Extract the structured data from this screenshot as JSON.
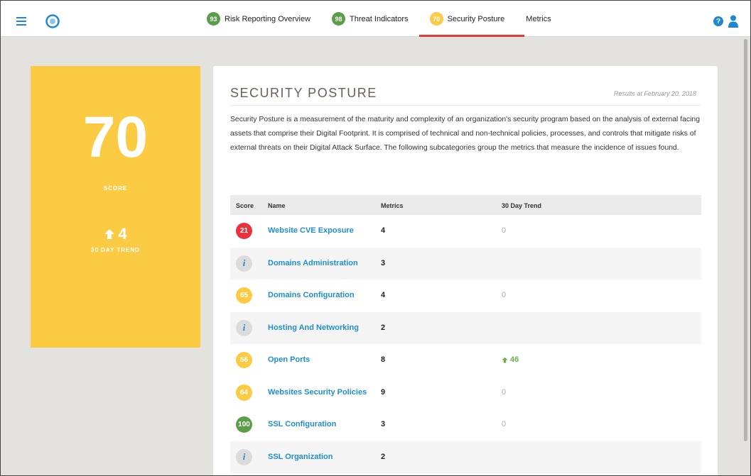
{
  "nav": {
    "tabs": [
      {
        "score": "93",
        "label": "Risk Reporting Overview",
        "color": "#5a9e4a"
      },
      {
        "score": "98",
        "label": "Threat Indicators",
        "color": "#5a9e4a"
      },
      {
        "score": "70",
        "label": "Security Posture",
        "color": "#fbcb43",
        "active": true
      },
      {
        "score": "",
        "label": "Metrics"
      }
    ],
    "help_label": "?"
  },
  "score_card": {
    "score": "70",
    "score_label": "SCORE",
    "trend": "4",
    "trend_label": "30 DAY TREND",
    "color": "#fbcb43"
  },
  "panel": {
    "title": "SECURITY POSTURE",
    "date": "Results at February 20, 2018",
    "description": "Security Posture is a measurement of the maturity and complexity of an organization's security program based on the analysis of external facing assets that comprise their Digital Footprint.  It is comprised of technical and non-technical policies, processes, and controls that mitigate risks of external threats on their Digital Attack Surface.  The following subcategories group the metrics that measure the incidence of issues found."
  },
  "table": {
    "headers": {
      "score": "Score",
      "name": "Name",
      "metrics": "Metrics",
      "trend": "30 Day Trend"
    },
    "rows": [
      {
        "score": "21",
        "color": "#e8333e",
        "name": "Website CVE Exposure",
        "metrics": "4",
        "trend": "0"
      },
      {
        "score": "i",
        "info": true,
        "name": "Domains Administration",
        "metrics": "3",
        "trend": ""
      },
      {
        "score": "65",
        "color": "#fbcb43",
        "name": "Domains Configuration",
        "metrics": "4",
        "trend": "0"
      },
      {
        "score": "i",
        "info": true,
        "name": "Hosting And Networking",
        "metrics": "2",
        "trend": ""
      },
      {
        "score": "56",
        "color": "#fbcb43",
        "name": "Open Ports",
        "metrics": "8",
        "trend": "46",
        "up": true
      },
      {
        "score": "64",
        "color": "#fbcb43",
        "name": "Websites Security Policies",
        "metrics": "9",
        "trend": "0"
      },
      {
        "score": "100",
        "color": "#5a9e4a",
        "name": "SSL Configuration",
        "metrics": "3",
        "trend": "0"
      },
      {
        "score": "i",
        "info": true,
        "name": "SSL Organization",
        "metrics": "2",
        "trend": ""
      }
    ]
  },
  "colors": {
    "accent": "#1e88d0",
    "active_tab_underline": "#e23c3c",
    "trend_up": "#6ab04c"
  }
}
